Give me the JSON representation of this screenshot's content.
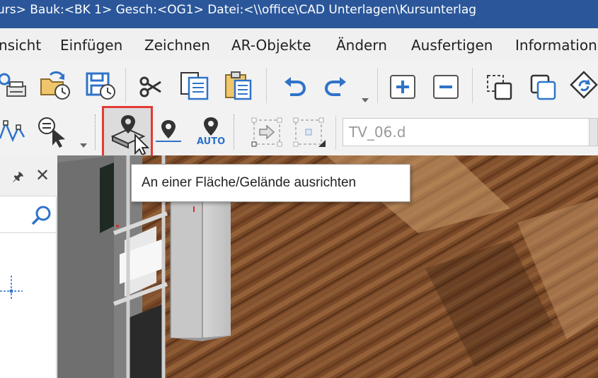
{
  "titlebar": {
    "text": "urs> Bauk:<BK 1>  Gesch:<OG1>  Datei:<\\\\office\\CAD Unterlagen\\Kursunterlag"
  },
  "menu": [
    {
      "label": "nsicht"
    },
    {
      "label": "Einfügen"
    },
    {
      "label": "Zeichnen"
    },
    {
      "label": "AR-Objekte"
    },
    {
      "label": "Ändern"
    },
    {
      "label": "Ausfertigen"
    },
    {
      "label": "Information"
    }
  ],
  "toolbar2": {
    "auto_label": "AUTO"
  },
  "combo": {
    "value": "TV_06.d"
  },
  "tooltip": {
    "text": "An einer Fläche/Gelände ausrichten"
  },
  "colors": {
    "titlebar": "#2b579a",
    "highlight": "#e53935",
    "accent_blue": "#2f73c9"
  },
  "icons": {
    "toolbar1": [
      "print-preview-icon",
      "open-folder-recent-icon",
      "save-recent-icon",
      "scissors-icon",
      "copy-icon",
      "paste-icon",
      "undo-icon",
      "redo-icon",
      "zoom-in-icon",
      "zoom-out-icon",
      "duplicate-icon",
      "copy-frame-icon",
      "rotate-icon"
    ],
    "toolbar2": [
      "polyline-icon",
      "select-filter-icon",
      "align-surface-icon",
      "align-line-icon",
      "align-auto-icon",
      "move-object-icon",
      "grid-snap-icon"
    ]
  }
}
